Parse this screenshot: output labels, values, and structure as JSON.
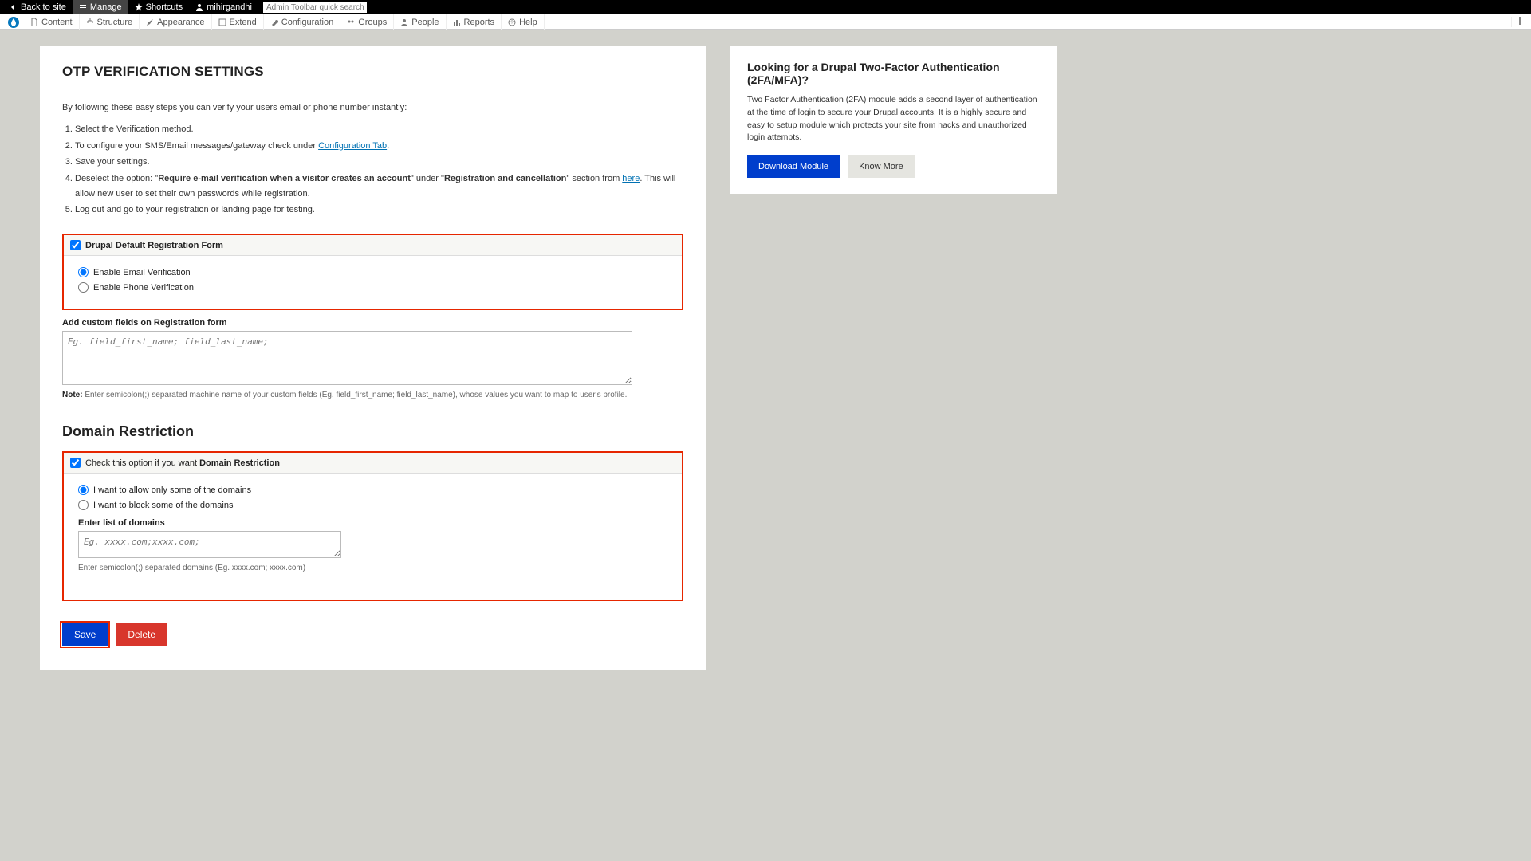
{
  "topbar": {
    "back": "Back to site",
    "manage": "Manage",
    "shortcuts": "Shortcuts",
    "user": "mihirgandhi",
    "search_placeholder": "Admin Toolbar quick search"
  },
  "secondbar": {
    "items": [
      "Content",
      "Structure",
      "Appearance",
      "Extend",
      "Configuration",
      "Groups",
      "People",
      "Reports",
      "Help"
    ]
  },
  "page": {
    "title": "OTP VERIFICATION SETTINGS",
    "intro": "By following these easy steps you can verify your users email or phone number instantly:",
    "steps": {
      "s1": "Select the Verification method.",
      "s2a": "To configure your SMS/Email messages/gateway check under ",
      "s2link": "Configuration Tab",
      "s2b": ".",
      "s3": "Save your settings.",
      "s4a": "Deselect the option: \"",
      "s4bold1": "Require e-mail verification when a visitor creates an account",
      "s4b": "\" under \"",
      "s4bold2": "Registration and cancellation",
      "s4c": "\" section from ",
      "s4link": "here",
      "s4d": ". This will allow new user to set their own passwords while registration.",
      "s5": "Log out and go to your registration or landing page for testing."
    },
    "regform": {
      "checkbox_label": "Drupal Default Registration Form",
      "radio_email": "Enable Email Verification",
      "radio_phone": "Enable Phone Verification"
    },
    "custom_fields": {
      "label": "Add custom fields on Registration form",
      "placeholder": "Eg. field_first_name; field_last_name;",
      "note_prefix": "Note:",
      "note": " Enter semicolon(;) separated machine name of your custom fields (Eg. field_first_name; field_last_name), whose values you want to map to user's profile."
    },
    "domain": {
      "title": "Domain Restriction",
      "checkbox_pre": "Check this option if you want ",
      "checkbox_bold": "Domain Restriction",
      "radio_allow": "I want to allow only some of the domains",
      "radio_block": "I want to block some of the domains",
      "list_label": "Enter list of domains",
      "list_placeholder": "Eg. xxxx.com;xxxx.com;",
      "list_note": "Enter semicolon(;) separated domains (Eg. xxxx.com; xxxx.com)"
    },
    "buttons": {
      "save": "Save",
      "delete": "Delete"
    }
  },
  "side": {
    "title": "Looking for a Drupal Two-Factor Authentication (2FA/MFA)?",
    "text": "Two Factor Authentication (2FA) module adds a second layer of authentication at the time of login to secure your Drupal accounts. It is a highly secure and easy to setup module which protects your site from hacks and unauthorized login attempts.",
    "download": "Download Module",
    "know": "Know More"
  }
}
